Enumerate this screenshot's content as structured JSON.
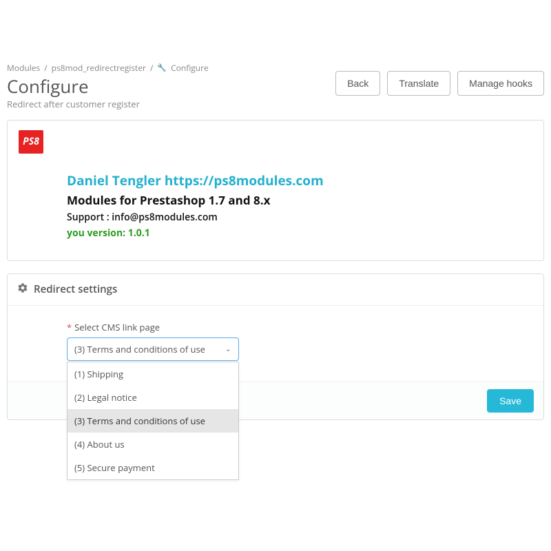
{
  "breadcrumb": {
    "item1": "Modules",
    "item2": "ps8mod_redirectregister",
    "item3": "Configure"
  },
  "header": {
    "title": "Configure",
    "subtitle": "Redirect after customer register",
    "buttons": {
      "back": "Back",
      "translate": "Translate",
      "manage_hooks": "Manage hooks"
    }
  },
  "info_panel": {
    "logo_text": "PS8",
    "author_link": "Daniel Tengler https://ps8modules.com",
    "modules_for": "Modules for Prestashop 1.7 and 8.x",
    "support": "Support : info@ps8modules.com",
    "version": "you version: 1.0.1"
  },
  "settings_panel": {
    "heading": "Redirect settings",
    "field_label": "Select CMS link page",
    "selected_value": "(3) Terms and conditions of use",
    "options": [
      "(1) Shipping",
      "(2) Legal notice",
      "(3) Terms and conditions of use",
      "(4) About us",
      "(5) Secure payment"
    ],
    "selected_index": 2,
    "save_label": "Save"
  }
}
